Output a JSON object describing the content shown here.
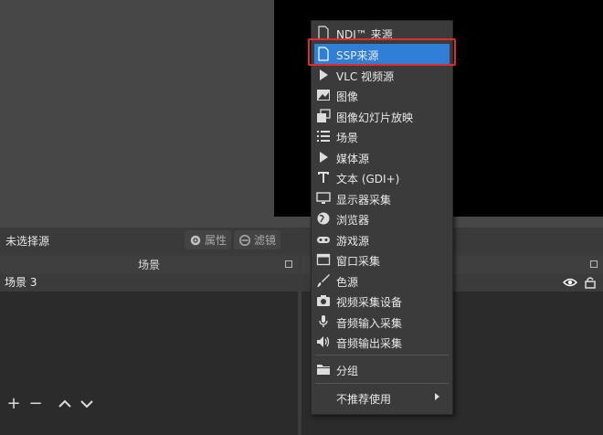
{
  "toolbar": {
    "no_source_label": "未选择源",
    "properties_label": "属性",
    "filters_label": "滤镜"
  },
  "scenes": {
    "title": "场景",
    "items": [
      "场景 3"
    ]
  },
  "menu": {
    "items": [
      {
        "label": "NDI™ 来源",
        "icon": "file-icon"
      },
      {
        "label": "SSP来源",
        "icon": "file-icon",
        "selected": true
      },
      {
        "label": "VLC 视频源",
        "icon": "play-icon"
      },
      {
        "label": "图像",
        "icon": "image-icon"
      },
      {
        "label": "图像幻灯片放映",
        "icon": "slideshow-icon"
      },
      {
        "label": "场景",
        "icon": "list-icon"
      },
      {
        "label": "媒体源",
        "icon": "play-icon"
      },
      {
        "label": "文本 (GDI+)",
        "icon": "text-icon"
      },
      {
        "label": "显示器采集",
        "icon": "monitor-icon"
      },
      {
        "label": "浏览器",
        "icon": "globe-icon"
      },
      {
        "label": "游戏源",
        "icon": "gamepad-icon"
      },
      {
        "label": "窗口采集",
        "icon": "window-icon"
      },
      {
        "label": "色源",
        "icon": "brush-icon"
      },
      {
        "label": "视频采集设备",
        "icon": "camera-icon"
      },
      {
        "label": "音频输入采集",
        "icon": "microphone-icon"
      },
      {
        "label": "音频输出采集",
        "icon": "speaker-icon"
      }
    ],
    "group_label": "分组",
    "deprecated_label": "不推荐使用"
  },
  "colors": {
    "highlight_border": "#e32b2b",
    "selected_bg": "#2f7fd6"
  }
}
